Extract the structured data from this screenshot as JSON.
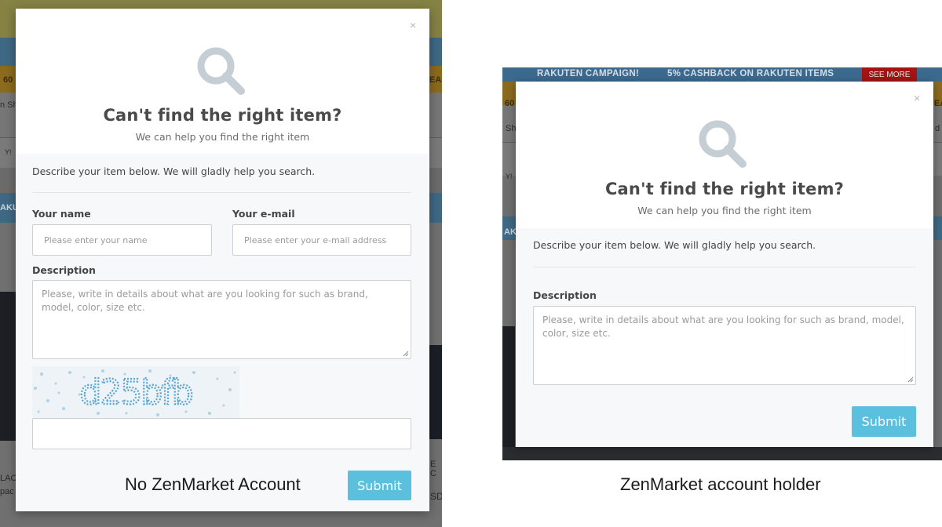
{
  "left_background": {
    "fragments": [
      "60",
      "EA",
      "n Sh",
      "Y!",
      "AKU",
      "LAC",
      "pac",
      "E C",
      "SD"
    ]
  },
  "right_background": {
    "banner_campaign": "RAKUTEN CAMPAIGN!",
    "banner_cashback": "5% CASHBACK ON RAKUTEN ITEMS",
    "banner_see_more": "SEE MORE",
    "fragments": [
      "60",
      "EA",
      "Sh",
      "d",
      "Y!",
      "AK"
    ]
  },
  "modal_guest": {
    "close": "×",
    "title": "Can't find the right item?",
    "subtitle": "We can help you find the right item",
    "intro": "Describe your item below. We will gladly help you search.",
    "name_label": "Your name",
    "name_placeholder": "Please enter your name",
    "email_label": "Your e-mail",
    "email_placeholder": "Please enter your e-mail address",
    "description_label": "Description",
    "description_placeholder": "Please, write in details about what are you looking for such as brand, model, color, size etc.",
    "captcha_text": "d25bfb",
    "submit_label": "Submit"
  },
  "modal_member": {
    "close": "×",
    "title": "Can't find the right item?",
    "subtitle": "We can help you find the right item",
    "intro": "Describe your item below. We will gladly help you search.",
    "description_label": "Description",
    "description_placeholder": "Please, write in details about what are you looking for such as brand, model, color, size etc.",
    "submit_label": "Submit"
  },
  "captions": {
    "left": "No ZenMarket Account",
    "right": "ZenMarket account holder"
  },
  "colors": {
    "accent": "#5bc0de",
    "icon": "#c5cdd5",
    "overlay_bg": "#6b6b6b"
  }
}
